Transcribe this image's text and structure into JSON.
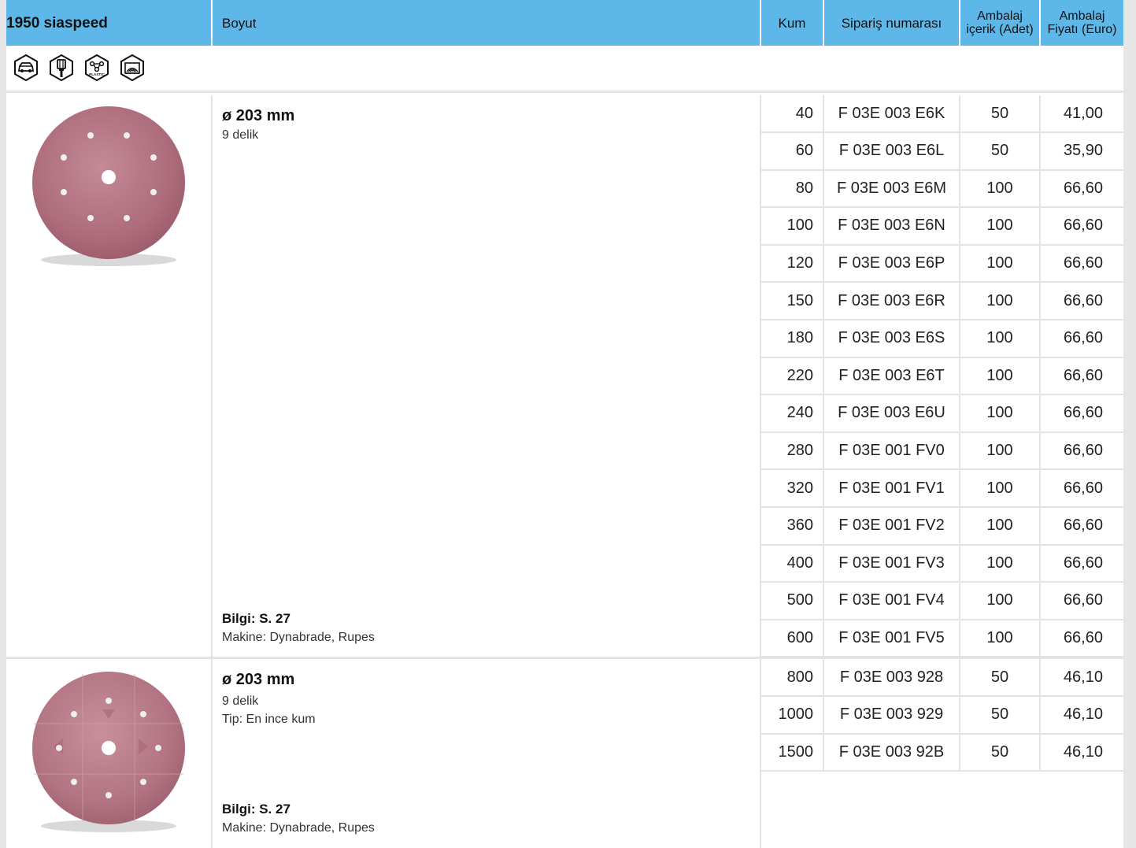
{
  "header": {
    "product": "1950 siaspeed",
    "size": "Boyut",
    "grit": "Kum",
    "order_no": "Sipariş numarası",
    "pack_content_1": "Ambalaj",
    "pack_content_2": "içerik (Adet)",
    "pack_price_1": "Ambalaj",
    "pack_price_2": "Fiyatı (Euro)",
    "bg_color": "#5db7e8"
  },
  "icons": [
    "car-body-icon",
    "paint-brush-icon",
    "plastic-icon",
    "wood-layers-icon"
  ],
  "icon_label_plastic": "PLASTIC",
  "products": [
    {
      "title": "ø 203 mm",
      "holes": "9 delik",
      "tip": "",
      "info": "Bilgi: S. 27",
      "machine": "Makine: Dynabrade, Rupes",
      "rows": [
        {
          "grit": "40",
          "order": "F 03E 003 E6K",
          "pack": "50",
          "price": "41,00"
        },
        {
          "grit": "60",
          "order": "F 03E 003 E6L",
          "pack": "50",
          "price": "35,90"
        },
        {
          "grit": "80",
          "order": "F 03E 003 E6M",
          "pack": "100",
          "price": "66,60"
        },
        {
          "grit": "100",
          "order": "F 03E 003 E6N",
          "pack": "100",
          "price": "66,60"
        },
        {
          "grit": "120",
          "order": "F 03E 003 E6P",
          "pack": "100",
          "price": "66,60"
        },
        {
          "grit": "150",
          "order": "F 03E 003 E6R",
          "pack": "100",
          "price": "66,60"
        },
        {
          "grit": "180",
          "order": "F 03E 003 E6S",
          "pack": "100",
          "price": "66,60"
        },
        {
          "grit": "220",
          "order": "F 03E 003 E6T",
          "pack": "100",
          "price": "66,60"
        },
        {
          "grit": "240",
          "order": "F 03E 003 E6U",
          "pack": "100",
          "price": "66,60"
        },
        {
          "grit": "280",
          "order": "F 03E 001 FV0",
          "pack": "100",
          "price": "66,60"
        },
        {
          "grit": "320",
          "order": "F 03E 001 FV1",
          "pack": "100",
          "price": "66,60"
        },
        {
          "grit": "360",
          "order": "F 03E 001 FV2",
          "pack": "100",
          "price": "66,60"
        },
        {
          "grit": "400",
          "order": "F 03E 001 FV3",
          "pack": "100",
          "price": "66,60"
        },
        {
          "grit": "500",
          "order": "F 03E 001 FV4",
          "pack": "100",
          "price": "66,60"
        },
        {
          "grit": "600",
          "order": "F 03E 001 FV5",
          "pack": "100",
          "price": "66,60"
        }
      ]
    },
    {
      "title": "ø 203 mm",
      "holes": "9 delik",
      "tip": "Tip: En ince kum",
      "info": "Bilgi: S. 27",
      "machine": "Makine: Dynabrade, Rupes",
      "rows": [
        {
          "grit": "800",
          "order": "F 03E 003 928",
          "pack": "50",
          "price": "46,10"
        },
        {
          "grit": "1000",
          "order": "F 03E 003 929",
          "pack": "50",
          "price": "46,10"
        },
        {
          "grit": "1500",
          "order": "F 03E 003 92B",
          "pack": "50",
          "price": "46,10"
        }
      ]
    }
  ],
  "disc_color": "#b0707f"
}
